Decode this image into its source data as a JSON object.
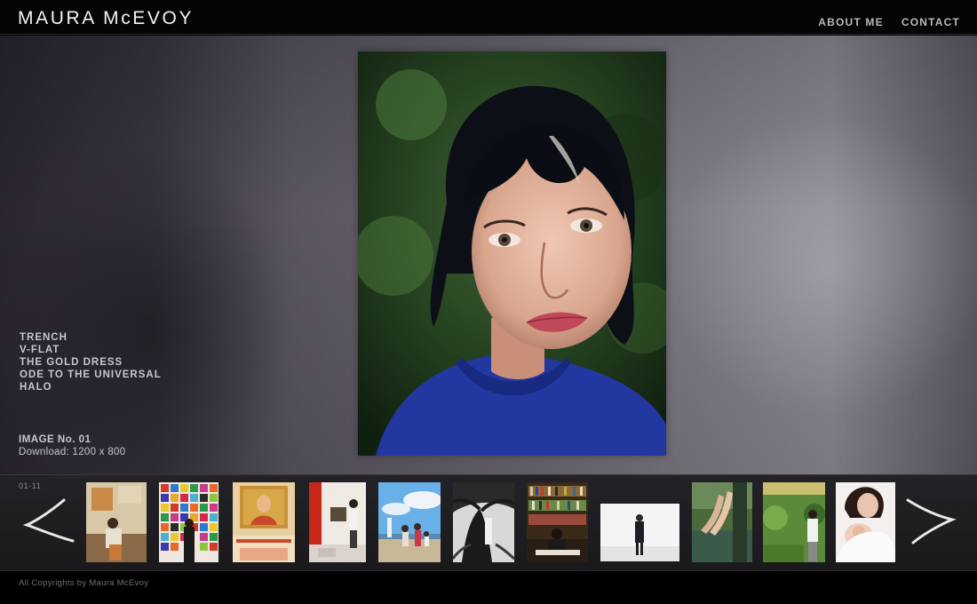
{
  "header": {
    "logo": "MAURA McEVOY",
    "nav": [
      "ABOUT ME",
      "CONTACT"
    ]
  },
  "projects": [
    "TRENCH",
    "V-FLAT",
    "THE GOLD DRESS",
    "ODE TO THE UNIVERSAL",
    "HALO"
  ],
  "current_image": {
    "number_label": "IMAGE No. 01",
    "download_label": "Download: 1200 x 800"
  },
  "filmstrip": {
    "counter": "01-11",
    "thumbnail_count": 11
  },
  "footer": {
    "copyright": "All Copyrights by Maura McEvoy"
  },
  "icons": {
    "prev": "chevron-left-icon",
    "next": "chevron-right-icon"
  },
  "colors": {
    "header_bg": "#050505",
    "nav_text": "#b8b8b8",
    "side_text": "#c8c6cc",
    "hoodie_blue": "#2238a0"
  }
}
